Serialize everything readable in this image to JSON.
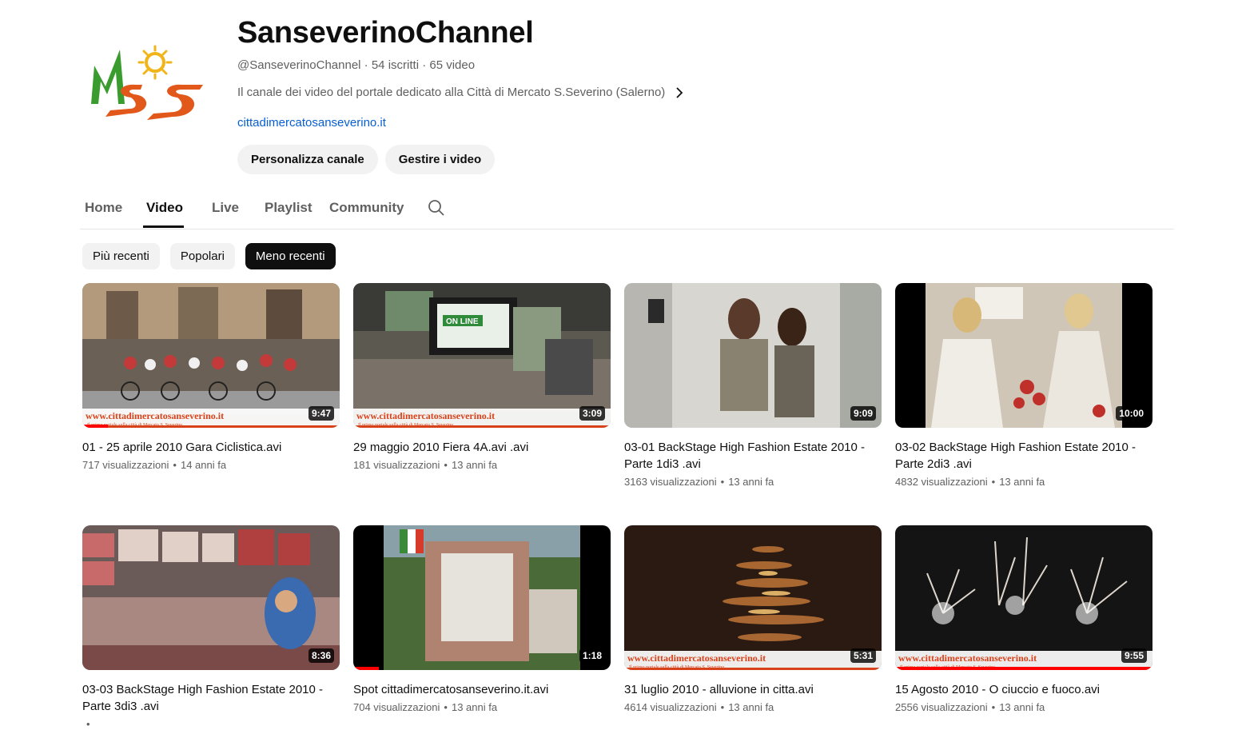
{
  "channel": {
    "name": "SanseverinoChannel",
    "handle": "@SanseverinoChannel",
    "subscribers": "54 iscritti",
    "video_count": "65 video",
    "separator": "·",
    "description": "Il canale dei video del portale dedicato alla Città di Mercato S.Severino (Salerno)",
    "website": "cittadimercatosanseverino.it",
    "logo_text": "MSS"
  },
  "buttons": {
    "customize": "Personalizza canale",
    "manage": "Gestire i video"
  },
  "tabs": [
    {
      "label": "Home",
      "active": false
    },
    {
      "label": "Video",
      "active": true
    },
    {
      "label": "Live",
      "active": false
    },
    {
      "label": "Playlist",
      "active": false
    },
    {
      "label": "Community",
      "active": false
    }
  ],
  "chips": [
    {
      "label": "Più recenti",
      "active": false
    },
    {
      "label": "Popolari",
      "active": false
    },
    {
      "label": "Meno recenti",
      "active": true
    }
  ],
  "videos": [
    {
      "title": "01 - 25 aprile 2010 Gara Ciclistica.avi",
      "views": "717 visualizzazioni",
      "age": "14 anni fa",
      "duration": "9:47",
      "progress": 0.1
    },
    {
      "title": "29 maggio 2010 Fiera 4A.avi .avi",
      "views": "181 visualizzazioni",
      "age": "13 anni fa",
      "duration": "3:09",
      "progress": 0
    },
    {
      "title": "03-01 BackStage High Fashion Estate 2010 - Parte 1di3 .avi",
      "views": "3163 visualizzazioni",
      "age": "13 anni fa",
      "duration": "9:09",
      "progress": 0
    },
    {
      "title": "03-02 BackStage High Fashion Estate 2010 - Parte 2di3 .avi",
      "views": "4832 visualizzazioni",
      "age": "13 anni fa",
      "duration": "10:00",
      "progress": 0
    },
    {
      "title": "03-03 BackStage High Fashion Estate 2010 - Parte 3di3 .avi",
      "views": "",
      "age": "",
      "duration": "8:36",
      "progress": 0
    },
    {
      "title": "Spot cittadimercatosanseverino.it.avi",
      "views": "704 visualizzazioni",
      "age": "13 anni fa",
      "duration": "1:18",
      "progress": 0.1
    },
    {
      "title": "31 luglio 2010 - alluvione in citta.avi",
      "views": "4614 visualizzazioni",
      "age": "13 anni fa",
      "duration": "5:31",
      "progress": 0
    },
    {
      "title": "15 Agosto 2010 - O ciuccio e fuoco.avi",
      "views": "2556 visualizzazioni",
      "age": "13 anni fa",
      "duration": "9:55",
      "progress": 1
    }
  ],
  "watermark": {
    "url": "www.cittadimercatosanseverino.it",
    "tagline": "Il primo portale sulla città di Mercato S. Severino"
  },
  "colors": {
    "link": "#065fd4",
    "progress": "#ff0000",
    "chip_active": "#0f0f0f",
    "logo_green": "#3a9b2f",
    "logo_orange": "#e2581b",
    "logo_yellow": "#f1b51a"
  }
}
